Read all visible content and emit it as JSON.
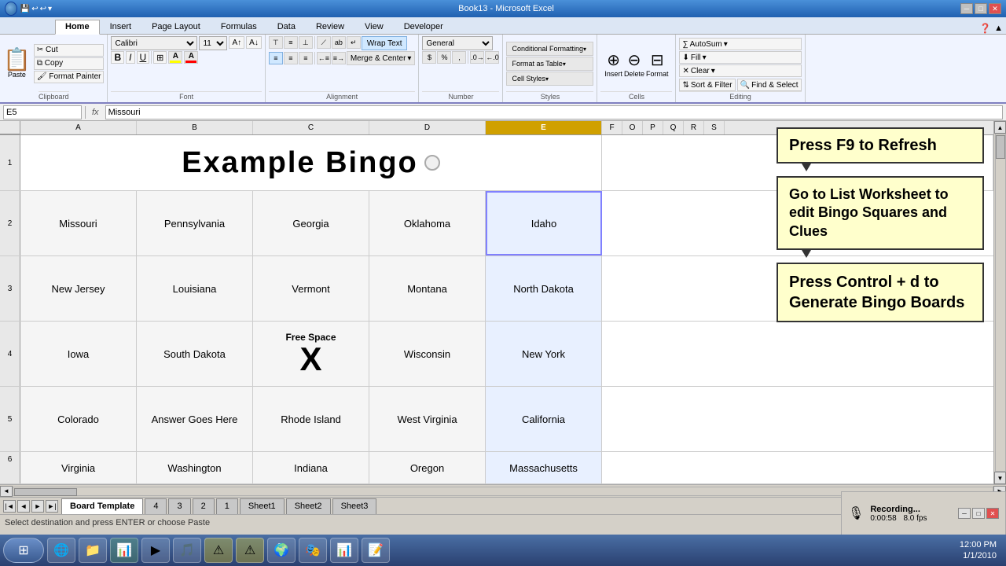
{
  "window": {
    "title": "Book13 - Microsoft Excel",
    "minimize": "─",
    "maximize": "□",
    "close": "✕"
  },
  "quick_access": {
    "buttons": [
      "💾",
      "↩",
      "↩",
      "→",
      "▸"
    ]
  },
  "ribbon": {
    "tabs": [
      "Home",
      "Insert",
      "Page Layout",
      "Formulas",
      "Data",
      "Review",
      "View",
      "Developer"
    ],
    "active_tab": "Home",
    "groups": {
      "clipboard": "Clipboard",
      "font": "Font",
      "alignment": "Alignment",
      "number": "Number",
      "styles": "Styles",
      "cells": "Cells",
      "editing": "Editing"
    },
    "font_name": "Calibri",
    "font_size": "11",
    "wrap_text": "Wrap Text",
    "merge_center": "Merge & Center",
    "number_format": "General",
    "autosum": "AutoSum",
    "fill": "Fill",
    "clear": "Clear",
    "sort_filter": "Sort & Filter",
    "find_select": "Find & Select",
    "conditional_formatting": "Conditional Formatting",
    "format_as_table": "Format as Table",
    "cell_styles": "Cell Styles",
    "insert": "Insert",
    "delete": "Delete",
    "format": "Format"
  },
  "formula_bar": {
    "name_box": "E5",
    "fx": "fx",
    "formula": "Missouri"
  },
  "columns": {
    "headers": [
      "A",
      "B",
      "C",
      "D",
      "E",
      "F",
      "O",
      "P",
      "Q",
      "R",
      "S"
    ],
    "widths": [
      148,
      148,
      148,
      148,
      148,
      26,
      26,
      26,
      26,
      26,
      26
    ]
  },
  "bingo": {
    "title": "Example Bingo",
    "rows": [
      [
        "Missouri",
        "Pennsylvania",
        "Georgia",
        "Oklahoma",
        "Idaho"
      ],
      [
        "New Jersey",
        "Louisiana",
        "Vermont",
        "Montana",
        "North Dakota"
      ],
      [
        "Iowa",
        "South Dakota",
        "Free Space\nX",
        "Wisconsin",
        "New York"
      ],
      [
        "Colorado",
        "Answer Goes Here",
        "Rhode Island",
        "West Virginia",
        "California"
      ],
      [
        "Virginia",
        "Washington",
        "Indiana",
        "Oregon",
        "Massachusetts"
      ]
    ],
    "free_space_label": "Free Space",
    "free_space_x": "X",
    "free_space_row": 2,
    "free_space_col": 2
  },
  "info_boxes": {
    "f9_box": "Press F9 to Refresh",
    "list_box": "Go to List Worksheet to edit Bingo Squares and Clues",
    "control_box": "Press Control + d to Generate Bingo Boards"
  },
  "row_numbers": [
    "",
    "1",
    "2",
    "3",
    "4",
    "5",
    "6"
  ],
  "sheet_tabs": [
    "Board Template",
    "4",
    "3",
    "2",
    "1",
    "Sheet1",
    "Sheet2",
    "Sheet3"
  ],
  "active_sheet": "Board Template",
  "status_bar": "Select destination and press ENTER or choose Paste",
  "recording": {
    "title": "Recording...",
    "time": "0:00:58",
    "fps": "8.0 fps"
  },
  "taskbar_icons": [
    "🪟",
    "🌐",
    "📁",
    "📊",
    "▶",
    "🎵",
    "⚠",
    "⚠",
    "🌍",
    "🎭",
    "📊",
    "📝"
  ]
}
